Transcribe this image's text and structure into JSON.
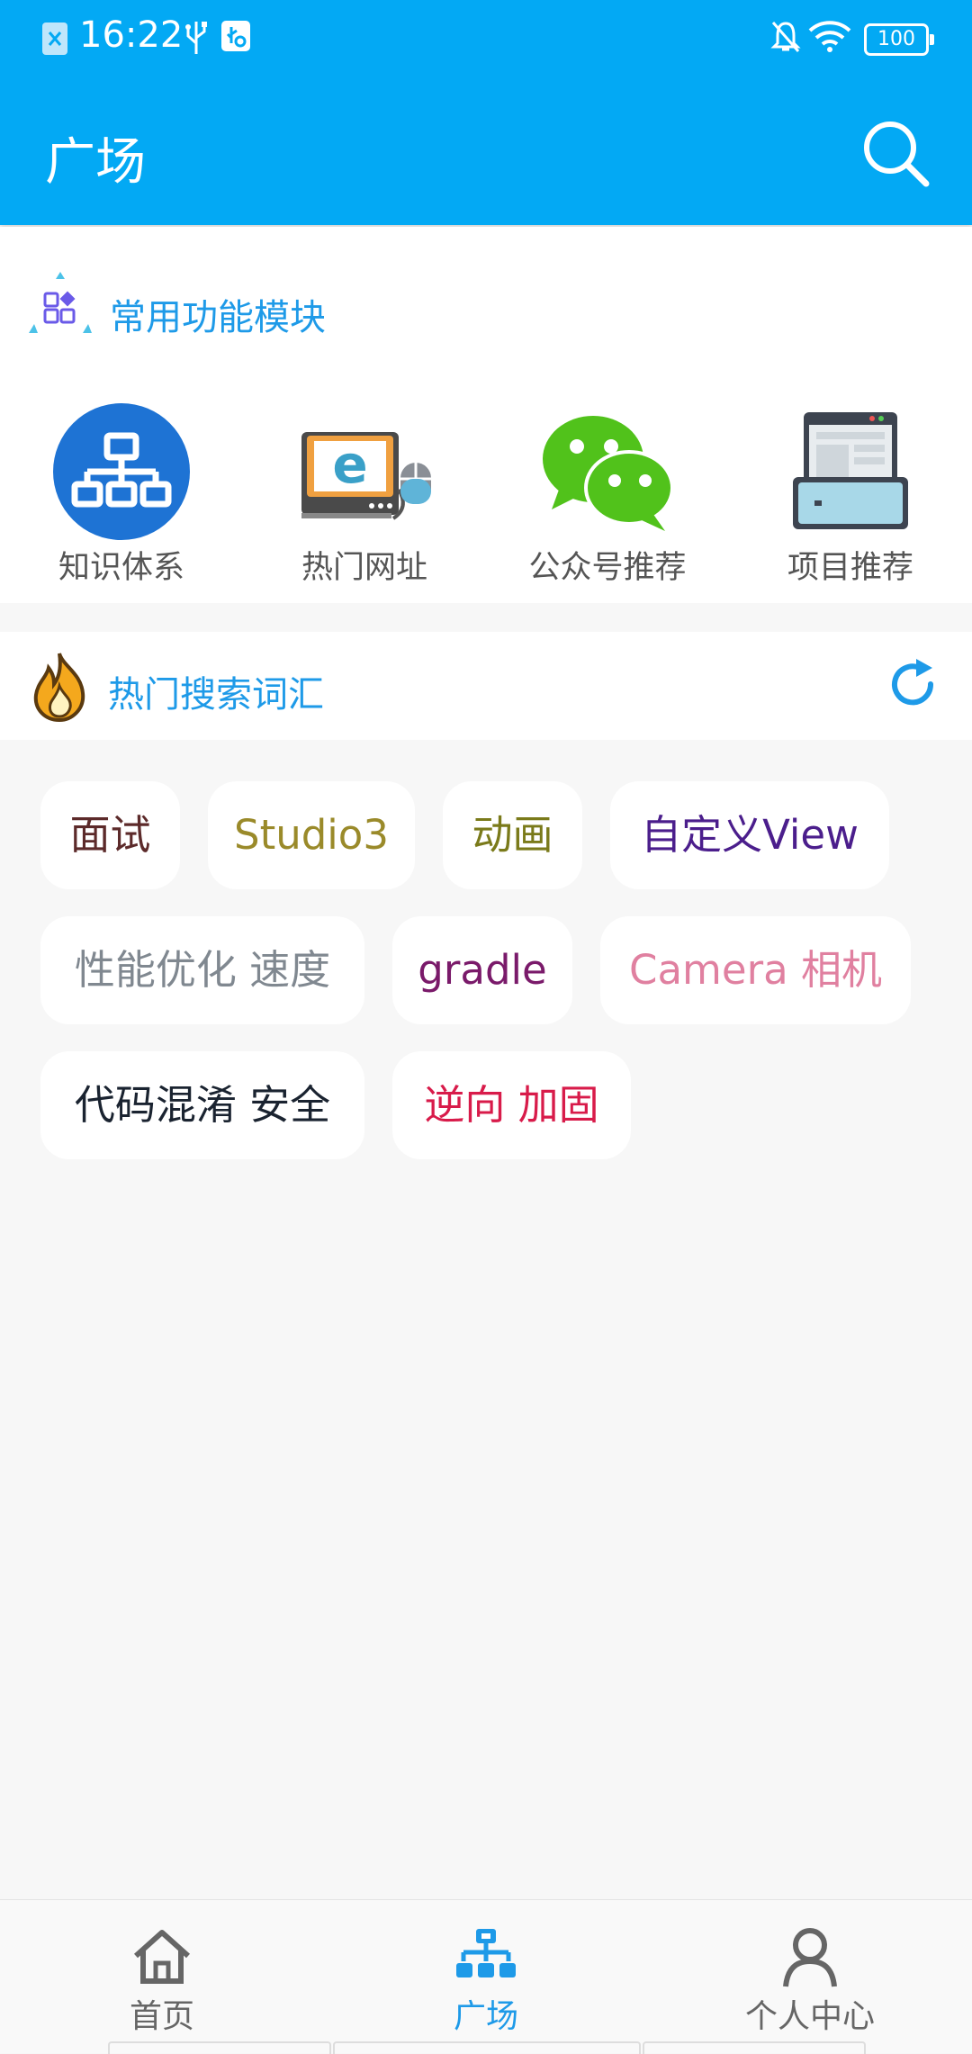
{
  "status_bar": {
    "time": "16:22",
    "battery": "100",
    "icons": [
      "sim-icon",
      "usb-icon",
      "usb-debug-icon",
      "mute-icon",
      "wifi-icon",
      "battery-icon"
    ]
  },
  "appbar": {
    "title": "广场",
    "background": "#03a9f4"
  },
  "modules_section": {
    "title": "常用功能模块",
    "items": [
      {
        "label": "知识体系",
        "icon": "sitemap-icon"
      },
      {
        "label": "热门网址",
        "icon": "browser-computer-icon"
      },
      {
        "label": "公众号推荐",
        "icon": "wechat-icon"
      },
      {
        "label": "项目推荐",
        "icon": "project-inbox-icon"
      }
    ]
  },
  "hot_section": {
    "title": "热门搜索词汇",
    "tags": [
      {
        "text": "面试",
        "color": "#5c2a2a"
      },
      {
        "text": "Studio3",
        "color": "#9a8a2a"
      },
      {
        "text": "动画",
        "color": "#7a7a1a"
      },
      {
        "text": "自定义View",
        "color": "#4b1e8c"
      },
      {
        "text": "性能优化 速度",
        "color": "#808890"
      },
      {
        "text": "gradle",
        "color": "#7a1a6a"
      },
      {
        "text": "Camera 相机",
        "color": "#e080a0"
      },
      {
        "text": "代码混淆 安全",
        "color": "#1a2330"
      },
      {
        "text": "逆向 加固",
        "color": "#d81b4a"
      }
    ]
  },
  "bottom_nav": {
    "items": [
      {
        "label": "首页",
        "icon": "home-icon",
        "active": false
      },
      {
        "label": "广场",
        "icon": "square-sitemap-icon",
        "active": true
      },
      {
        "label": "个人中心",
        "icon": "person-icon",
        "active": false
      }
    ],
    "active_color": "#1e9ae8",
    "inactive_color": "#666666"
  }
}
